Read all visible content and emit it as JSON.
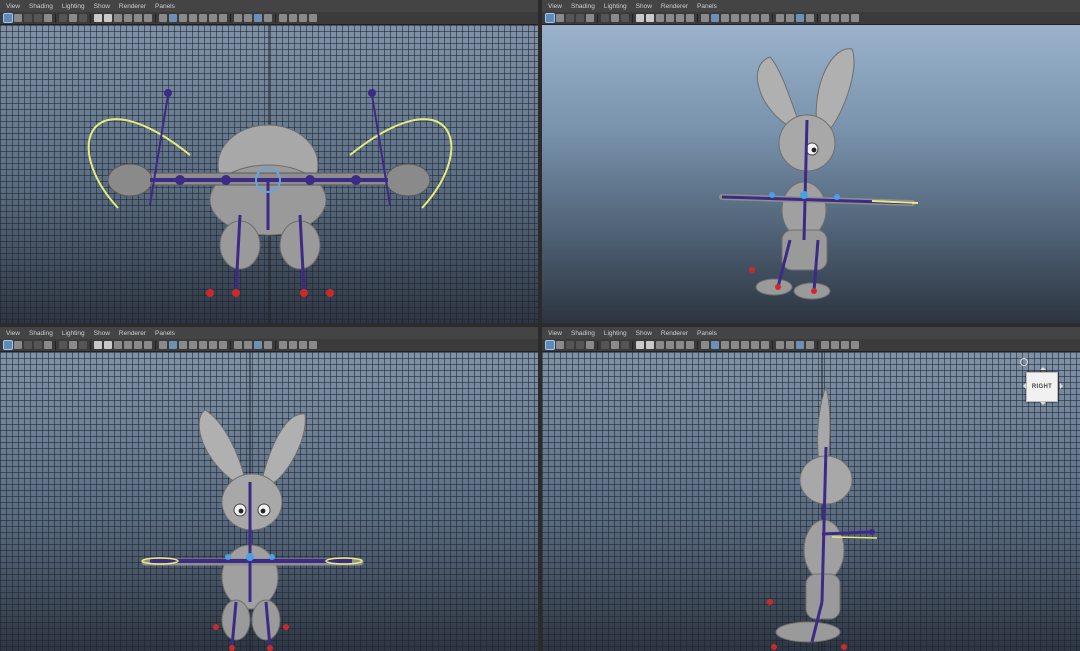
{
  "panels": [
    {
      "id": "top-left",
      "menu": [
        "View",
        "Shading",
        "Lighting",
        "Show",
        "Renderer",
        "Panels"
      ]
    },
    {
      "id": "top-right",
      "menu": [
        "View",
        "Shading",
        "Lighting",
        "Show",
        "Renderer",
        "Panels"
      ]
    },
    {
      "id": "bottom-left",
      "menu": [
        "View",
        "Shading",
        "Lighting",
        "Show",
        "Renderer",
        "Panels"
      ]
    },
    {
      "id": "bottom-right",
      "menu": [
        "View",
        "Shading",
        "Lighting",
        "Show",
        "Renderer",
        "Panels"
      ]
    }
  ],
  "view_cube": {
    "label": "RIGHT"
  },
  "colors": {
    "joint": "#3d2a86",
    "control_curve": "#e6ec7a",
    "foot_control": "#cc2a2a",
    "mesh": "#9c9c9c"
  }
}
